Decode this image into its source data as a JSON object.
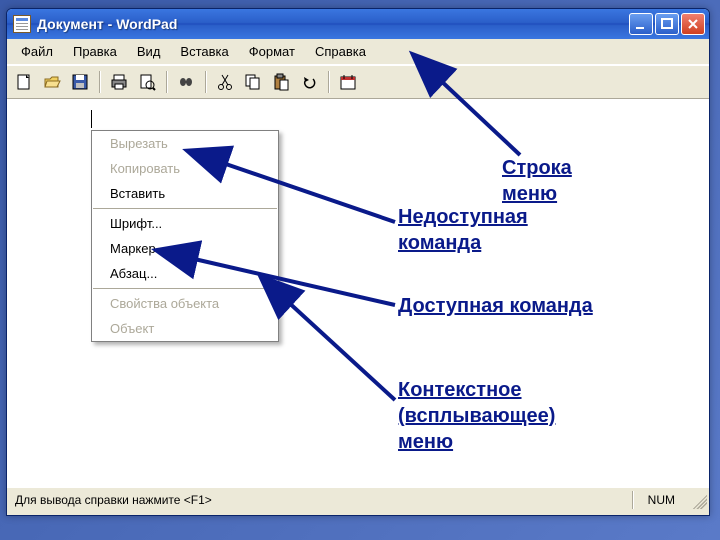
{
  "window": {
    "title": "Документ - WordPad"
  },
  "menubar": {
    "items": [
      "Файл",
      "Правка",
      "Вид",
      "Вставка",
      "Формат",
      "Справка"
    ]
  },
  "toolbar": {
    "icons": [
      "new-icon",
      "open-icon",
      "save-icon",
      "print-icon",
      "print-preview-icon",
      "find-icon",
      "cut-icon",
      "copy-icon",
      "paste-icon",
      "undo-icon",
      "datetime-icon"
    ]
  },
  "context_menu": {
    "groups": [
      [
        {
          "label": "Вырезать",
          "enabled": false
        },
        {
          "label": "Копировать",
          "enabled": false
        },
        {
          "label": "Вставить",
          "enabled": true
        }
      ],
      [
        {
          "label": "Шрифт...",
          "enabled": true
        },
        {
          "label": "Маркер",
          "enabled": true
        },
        {
          "label": "Абзац...",
          "enabled": true
        }
      ],
      [
        {
          "label": "Свойства объекта",
          "enabled": false
        },
        {
          "label": "Объект",
          "enabled": false
        }
      ]
    ]
  },
  "statusbar": {
    "help": "Для вывода справки нажмите <F1>",
    "num": "NUM"
  },
  "annotations": {
    "a1": "Строка\nменю",
    "a2": "Недоступная\nкоманда",
    "a3": "Доступная команда",
    "a4": "Контекстное\n(всплывающее)\nменю"
  }
}
